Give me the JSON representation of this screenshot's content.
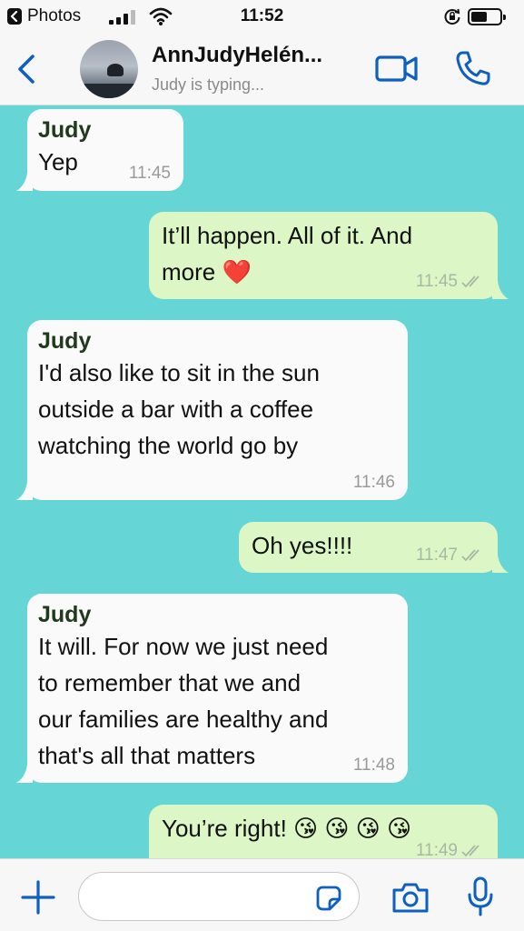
{
  "status_bar": {
    "back_app": "Photos",
    "time": "11:52"
  },
  "header": {
    "title": "AnnJudyHelén...",
    "subtitle": "Judy is typing..."
  },
  "colors": {
    "accent": "#0e5fbf",
    "chat_background": "#66d5d6",
    "incoming_bubble": "#fafafa",
    "outgoing_bubble": "#dcf6c5",
    "sender_name": "#213a1e"
  },
  "messages": [
    {
      "direction": "in",
      "sender": "Judy",
      "text": "Yep",
      "time": "11:45"
    },
    {
      "direction": "out",
      "text": "It’ll happen. All of it. And\nmore ❤️",
      "time": "11:45",
      "status": "read"
    },
    {
      "direction": "in",
      "sender": "Judy",
      "text": "I'd also like to sit in the sun\noutside a bar with a coffee\nwatching the world go by",
      "time": "11:46"
    },
    {
      "direction": "out",
      "text": "Oh yes!!!!",
      "time": "11:47",
      "status": "read"
    },
    {
      "direction": "in",
      "sender": "Judy",
      "text": "It will. For now we just need\nto remember that we and\nour families are healthy and\nthat's all that matters",
      "time": "11:48"
    },
    {
      "direction": "out",
      "text": "You’re right! 😘 😘 😘 😘",
      "time": "11:49",
      "status": "read"
    }
  ],
  "input_bar": {
    "placeholder": ""
  },
  "icons": {
    "back": "chevron-left-icon",
    "video": "video-camera-icon",
    "call": "phone-icon",
    "plus": "plus-icon",
    "sticker": "sticker-icon",
    "camera": "camera-icon",
    "mic": "microphone-icon",
    "read_status": "double-check-icon"
  }
}
